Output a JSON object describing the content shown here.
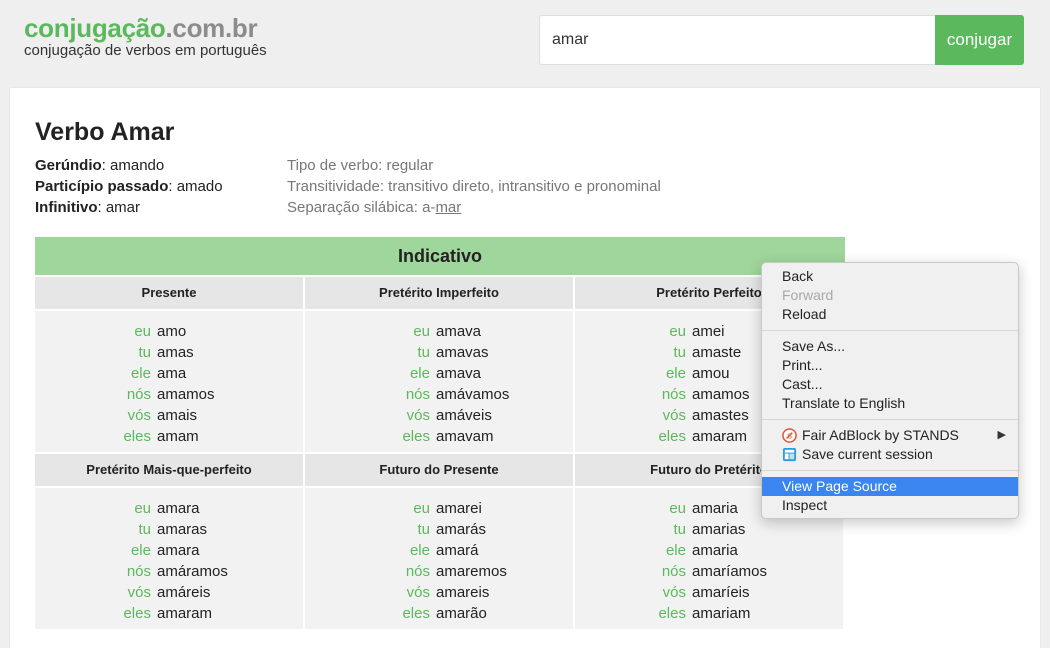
{
  "header": {
    "logo_main": "conjugação",
    "logo_domain": ".com.br",
    "subtitle": "conjugação de verbos em português",
    "search_value": "amar",
    "search_button": "conjugar"
  },
  "verb": {
    "title": "Verbo Amar",
    "gerundio_label": "Gerúndio",
    "gerundio": "amando",
    "participio_label": "Particípio passado",
    "participio": "amado",
    "infinitivo_label": "Infinitivo",
    "infinitivo": "amar",
    "tipo": "Tipo de verbo: regular",
    "transitividade": "Transitividade: transitivo direto, intransitivo e pronominal",
    "separacao_label": "Separação silábica: ",
    "separacao_a": "a-",
    "separacao_b": "mar"
  },
  "mood": "Indicativo",
  "pronouns": [
    "eu",
    "tu",
    "ele",
    "nós",
    "vós",
    "eles"
  ],
  "tenses": [
    {
      "name": "Presente",
      "forms": [
        "amo",
        "amas",
        "ama",
        "amamos",
        "amais",
        "amam"
      ]
    },
    {
      "name": "Pretérito Imperfeito",
      "forms": [
        "amava",
        "amavas",
        "amava",
        "amávamos",
        "amáveis",
        "amavam"
      ]
    },
    {
      "name": "Pretérito Perfeito",
      "forms": [
        "amei",
        "amaste",
        "amou",
        "amamos",
        "amastes",
        "amaram"
      ]
    },
    {
      "name": "Pretérito Mais-que-perfeito",
      "forms": [
        "amara",
        "amaras",
        "amara",
        "amáramos",
        "amáreis",
        "amaram"
      ]
    },
    {
      "name": "Futuro do Presente",
      "forms": [
        "amarei",
        "amarás",
        "amará",
        "amaremos",
        "amareis",
        "amarão"
      ]
    },
    {
      "name": "Futuro do Pretérito",
      "forms": [
        "amaria",
        "amarias",
        "amaria",
        "amaríamos",
        "amaríeis",
        "amariam"
      ]
    }
  ],
  "context_menu": {
    "back": "Back",
    "forward": "Forward",
    "reload": "Reload",
    "save_as": "Save As...",
    "print": "Print...",
    "cast": "Cast...",
    "translate": "Translate to English",
    "fair_adblock": "Fair AdBlock by STANDS",
    "save_session": "Save current session",
    "view_source": "View Page Source",
    "inspect": "Inspect",
    "highlight_color": "#3a85f0"
  },
  "colors": {
    "brand_green": "#5cb85c",
    "mood_bar": "#9fd69b"
  }
}
